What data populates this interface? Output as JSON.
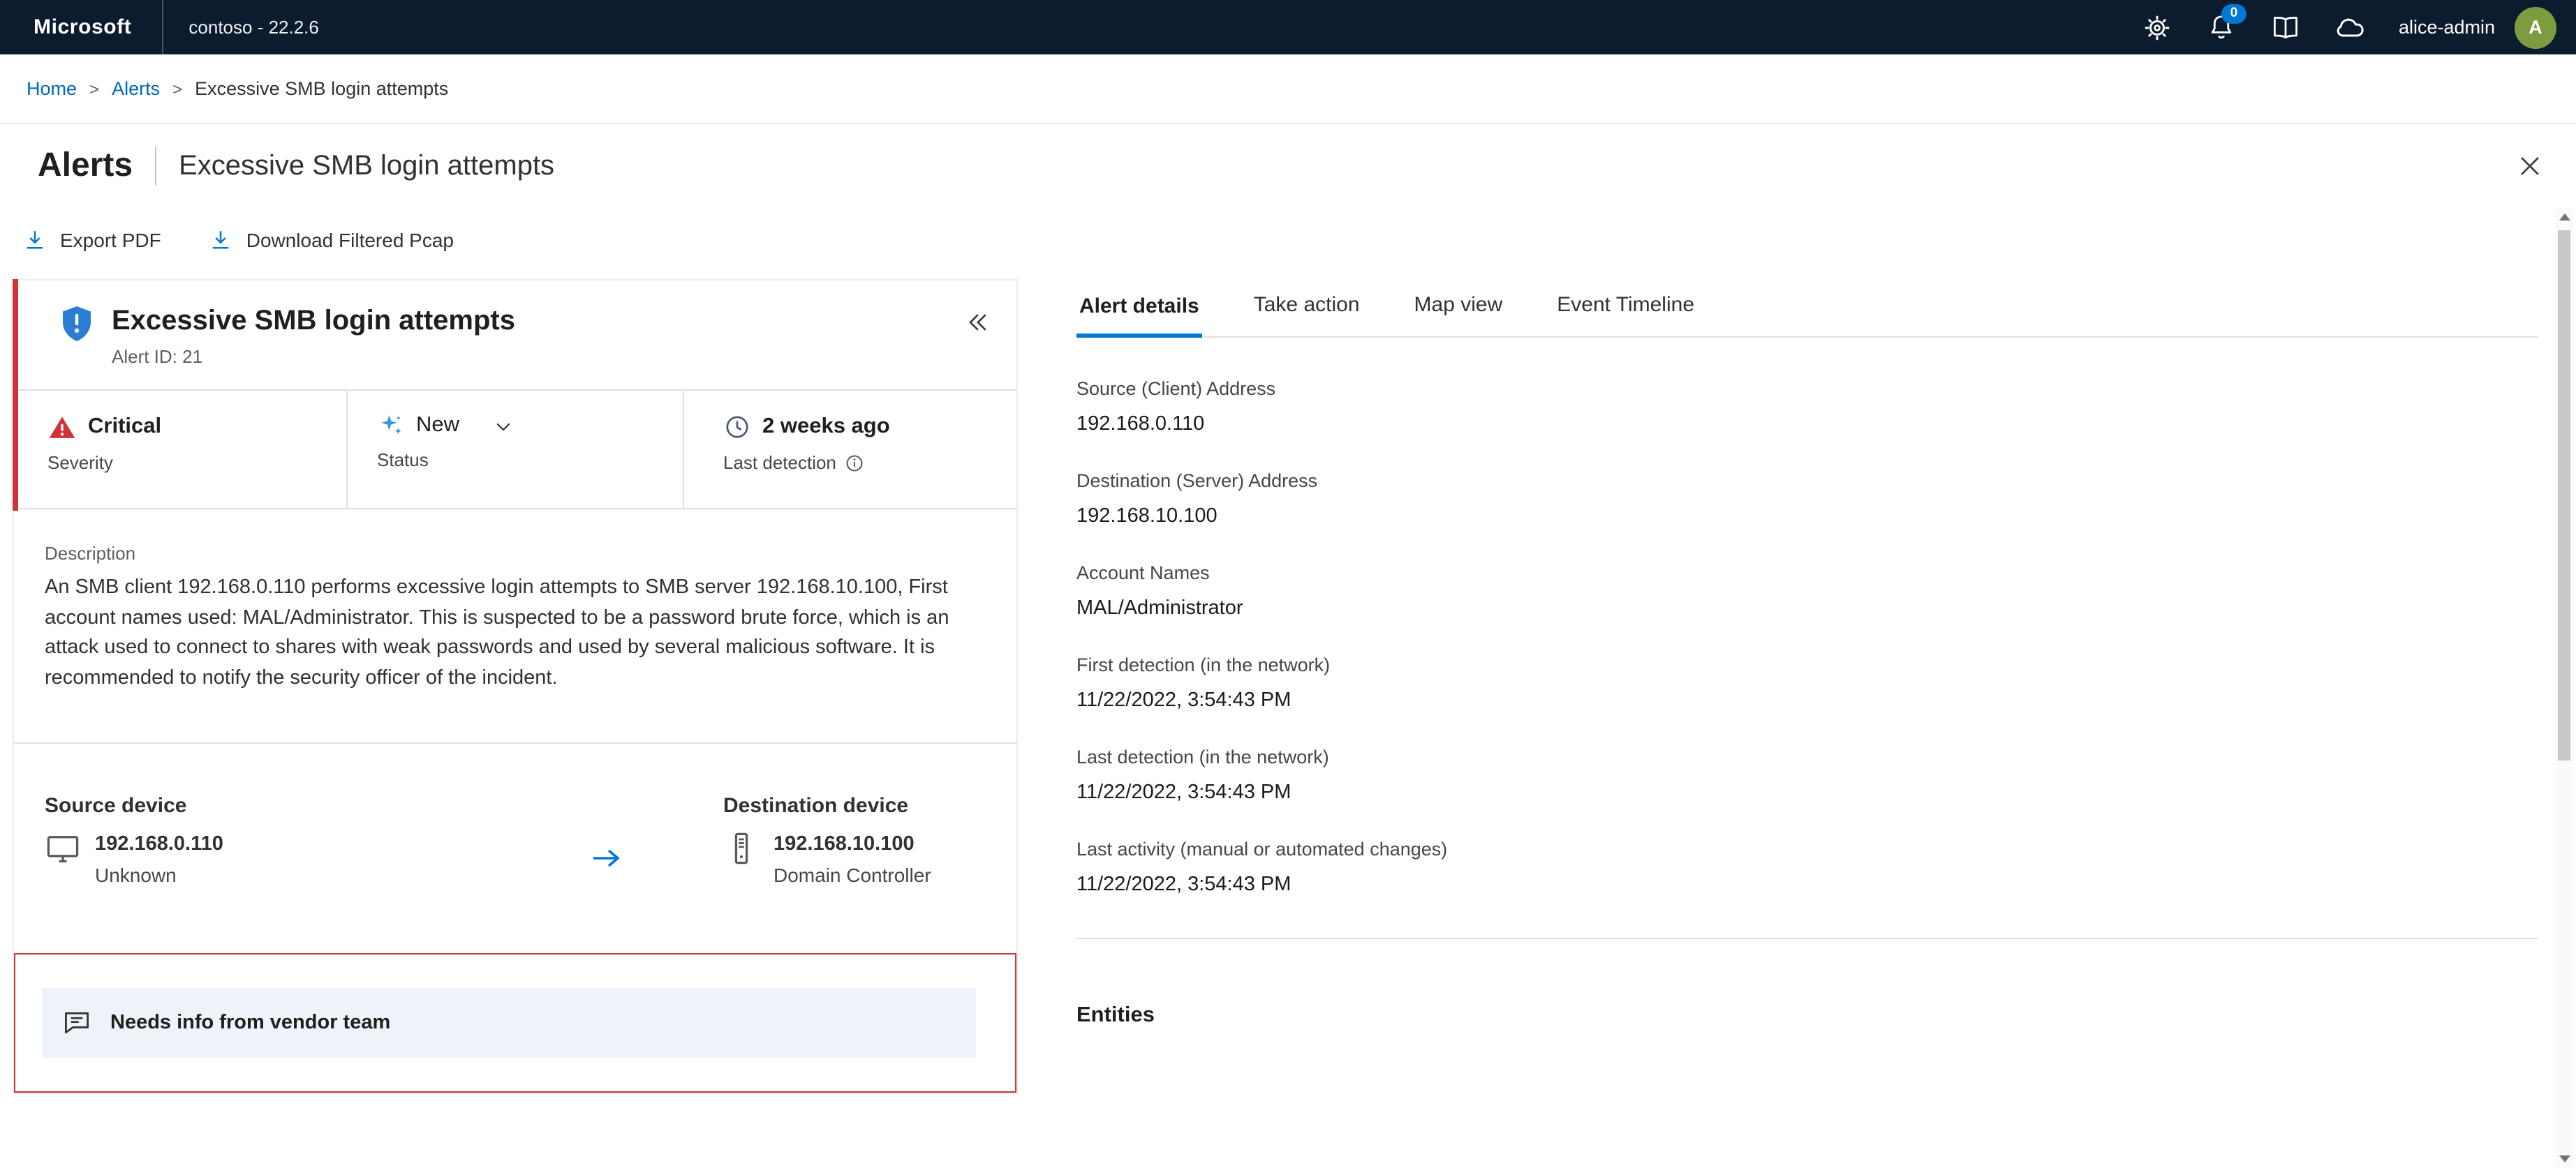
{
  "topbar": {
    "brand": "Microsoft",
    "environment": "contoso - 22.2.6",
    "notification_count": "0",
    "username": "alice-admin",
    "avatar_initial": "A",
    "icons": [
      "gear-icon",
      "bell-icon",
      "guide-book-icon",
      "cloud-icon"
    ]
  },
  "breadcrumb": {
    "separator": ">",
    "items": [
      {
        "label": "Home",
        "link": true
      },
      {
        "label": "Alerts",
        "link": true
      },
      {
        "label": "Excessive SMB login attempts",
        "link": false
      }
    ]
  },
  "page_header": {
    "section": "Alerts",
    "title": "Excessive SMB login attempts"
  },
  "toolbar": {
    "export_pdf": "Export PDF",
    "download_pcap": "Download Filtered Pcap"
  },
  "alert_card": {
    "title": "Excessive SMB login attempts",
    "alert_id": "Alert ID: 21",
    "severity": {
      "value": "Critical",
      "label": "Severity"
    },
    "status": {
      "value": "New",
      "label": "Status"
    },
    "detection": {
      "value": "2 weeks ago",
      "label": "Last detection"
    },
    "description_label": "Description",
    "description": "An SMB client 192.168.0.110 performs excessive login attempts to SMB server 192.168.10.100, First account names used: MAL/Administrator. This is suspected to be a password brute force, which is an attack used to connect to shares with weak passwords and used by several malicious software. It is recommended to notify the security officer of the incident.",
    "source_device": {
      "label": "Source device",
      "ip": "192.168.0.110",
      "type": "Unknown"
    },
    "destination_device": {
      "label": "Destination device",
      "ip": "192.168.10.100",
      "type": "Domain Controller"
    },
    "comment": "Needs info from vendor team"
  },
  "tabs": [
    {
      "label": "Alert details",
      "active": true
    },
    {
      "label": "Take action",
      "active": false
    },
    {
      "label": "Map view",
      "active": false
    },
    {
      "label": "Event Timeline",
      "active": false
    }
  ],
  "details": {
    "fields": [
      {
        "label": "Source (Client) Address",
        "value": "192.168.0.110"
      },
      {
        "label": "Destination (Server) Address",
        "value": "192.168.10.100"
      },
      {
        "label": "Account Names",
        "value": "MAL/Administrator"
      },
      {
        "label": "First detection (in the network)",
        "value": "11/22/2022, 3:54:43 PM"
      },
      {
        "label": "Last detection (in the network)",
        "value": "11/22/2022, 3:54:43 PM"
      },
      {
        "label": "Last activity (manual or automated changes)",
        "value": "11/22/2022, 3:54:43 PM"
      }
    ],
    "entities_heading": "Entities"
  },
  "colors": {
    "accent": "#0078d4",
    "link_blue": "#0067b8",
    "topbar_bg": "#0d1b2e",
    "critical_red": "#d13438",
    "status_new_blue": "#3a96dd",
    "avatar_green": "#7e9c3f",
    "comment_row_bg": "#eef3f9",
    "shield_blue": "#2b7cd3"
  }
}
